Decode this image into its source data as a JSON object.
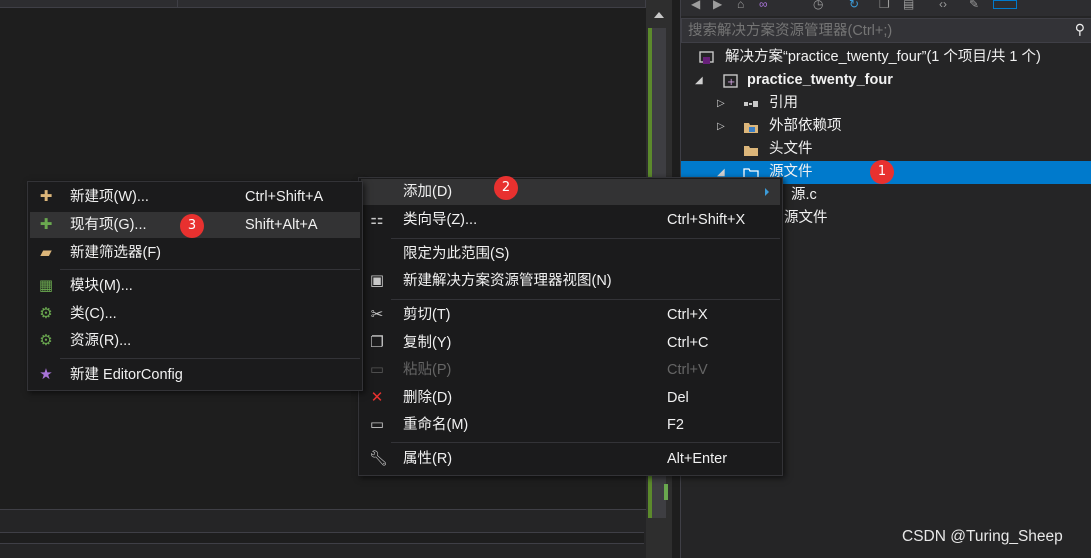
{
  "colors": {
    "accent": "#007acc",
    "badge": "#e8312f",
    "menu_bg": "#1b1b1c",
    "highlight": "#333334"
  },
  "explorer": {
    "toolbar_icons": [
      "back-icon",
      "forward-icon",
      "home-icon",
      "vs-icon",
      "history-icon",
      "sync-icon",
      "copy-icon",
      "pages-icon",
      "code-icon",
      "wrench-icon",
      "preview-icon"
    ],
    "search": {
      "placeholder": "搜索解决方案资源管理器(Ctrl+;)"
    },
    "tree": {
      "solution": "解决方案“practice_twenty_four”(1 个项目/共 1 个)",
      "project": "practice_twenty_four",
      "references": "引用",
      "external_deps": "外部依赖项",
      "header_files": "头文件",
      "source_files": "源文件",
      "source_c": "源.c",
      "resource_files": "源文件"
    }
  },
  "context_menu": {
    "add": {
      "label": "添加(D)"
    },
    "class_wizard": {
      "label": "类向导(Z)...",
      "key": "Ctrl+Shift+X"
    },
    "scope": {
      "label": "限定为此范围(S)"
    },
    "new_view": {
      "label": "新建解决方案资源管理器视图(N)"
    },
    "cut": {
      "label": "剪切(T)",
      "key": "Ctrl+X"
    },
    "copy": {
      "label": "复制(Y)",
      "key": "Ctrl+C"
    },
    "paste": {
      "label": "粘贴(P)",
      "key": "Ctrl+V"
    },
    "delete": {
      "label": "删除(D)",
      "key": "Del"
    },
    "rename": {
      "label": "重命名(M)",
      "key": "F2"
    },
    "properties": {
      "label": "属性(R)",
      "key": "Alt+Enter"
    }
  },
  "add_submenu": {
    "new_item": {
      "label": "新建项(W)...",
      "key": "Ctrl+Shift+A"
    },
    "existing_item": {
      "label": "现有项(G)...",
      "key": "Shift+Alt+A"
    },
    "new_filter": {
      "label": "新建筛选器(F)"
    },
    "module": {
      "label": "模块(M)..."
    },
    "class": {
      "label": "类(C)..."
    },
    "resource": {
      "label": "资源(R)..."
    },
    "editorconfig": {
      "label": "新建 EditorConfig"
    }
  },
  "badges": {
    "one": "1",
    "two": "2",
    "three": "3"
  },
  "watermark": "CSDN @Turing_Sheep"
}
